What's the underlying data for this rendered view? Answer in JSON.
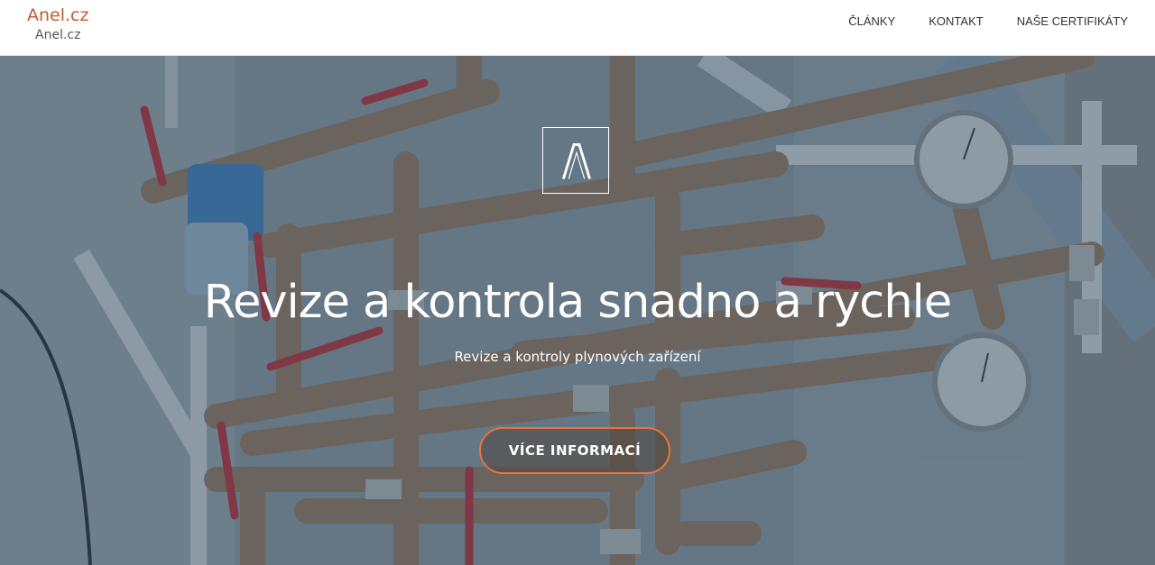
{
  "header": {
    "brand_title": "Anel.cz",
    "brand_subtitle": "Anel.cz",
    "nav": [
      {
        "label": "ČLÁNKY"
      },
      {
        "label": "KONTAKT"
      },
      {
        "label": "NAŠE CERTIFIKÁTY"
      }
    ]
  },
  "hero": {
    "logo_icon": "lambda-logo-icon",
    "title": "Revize a kontrola snadno a rychle",
    "subtitle": "Revize a kontroly plynových zařízení",
    "cta_label": "VÍCE INFORMACÍ",
    "background": "photo of copper pipes with red ball valves and pressure gauges"
  },
  "colors": {
    "brand": "#c25a2c",
    "cta_border": "#e8743b",
    "nav_text": "#333333",
    "overlay": "#344e64"
  }
}
